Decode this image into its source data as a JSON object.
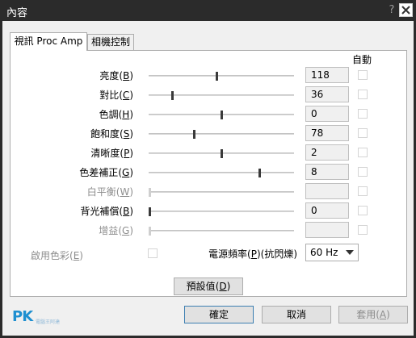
{
  "window": {
    "title": "內容",
    "help_glyph": "?",
    "close_glyph": "×"
  },
  "tabs": [
    {
      "label": "視訊 Proc Amp"
    },
    {
      "label": "相機控制"
    }
  ],
  "auto_header": "自動",
  "rows": [
    {
      "label": "亮度",
      "key": "B",
      "value": "118",
      "level": 0.47,
      "enabled": true
    },
    {
      "label": "對比",
      "key": "C",
      "value": "36",
      "level": 0.16,
      "enabled": true
    },
    {
      "label": "色調",
      "key": "H",
      "value": "0",
      "level": 0.5,
      "enabled": true
    },
    {
      "label": "飽和度",
      "key": "S",
      "value": "78",
      "level": 0.31,
      "enabled": true
    },
    {
      "label": "清晰度",
      "key": "P",
      "value": "2",
      "level": 0.5,
      "enabled": true
    },
    {
      "label": "色差補正",
      "key": "G",
      "value": "8",
      "level": 0.77,
      "enabled": true
    },
    {
      "label": "白平衡",
      "key": "W",
      "value": "",
      "level": 0.0,
      "enabled": false
    },
    {
      "label": "背光補償",
      "key": "B",
      "value": "0",
      "level": 0.0,
      "enabled": true
    },
    {
      "label": "增益",
      "key": "G",
      "value": "",
      "level": 0.0,
      "enabled": false
    }
  ],
  "enable_color": {
    "label": "啟用色彩",
    "key": "E"
  },
  "power_line": {
    "label": "電源頻率",
    "key": "P",
    "suffix": "(抗閃爍)",
    "value": "60 Hz"
  },
  "buttons": {
    "default": {
      "label": "預設值",
      "key": "D"
    },
    "ok": "確定",
    "cancel": "取消",
    "apply": {
      "label": "套用",
      "key": "A"
    }
  },
  "watermark": {
    "brand": "PK",
    "tagline": "電腦王阿達"
  }
}
